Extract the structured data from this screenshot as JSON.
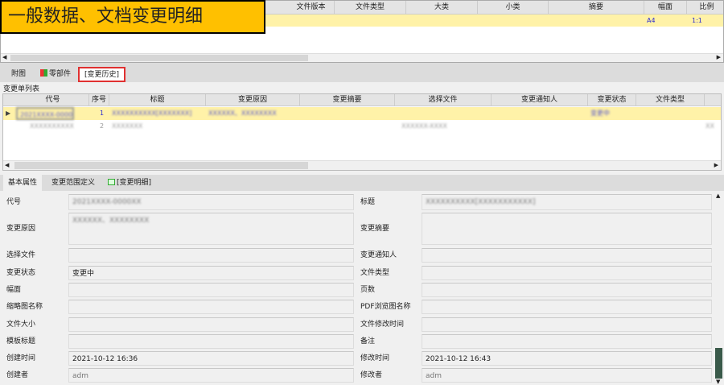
{
  "overlay_title": "一般数据、文档变更明细",
  "top_grid": {
    "columns": [
      "文件版本",
      "文件类型",
      "大类",
      "小类",
      "摘要",
      "幅面",
      "比例"
    ],
    "row": {
      "size": "A4",
      "scale": "1:1"
    }
  },
  "top_tabs": [
    "附图",
    "零部件",
    "[变更历史]"
  ],
  "change_list": {
    "title": "变更单列表",
    "columns": [
      "代号",
      "序号",
      "标题",
      "变更原因",
      "变更摘要",
      "选择文件",
      "变更通知人",
      "变更状态",
      "文件类型"
    ],
    "rows": [
      {
        "indicator": "▶",
        "code": "2021XXXX-0000XX",
        "seq": "1",
        "title": "XXXXXXXXXX[XXXXXXX]",
        "reason": "XXXXXX、XXXXXXXX",
        "file": "",
        "status": "变更中",
        "type": ""
      },
      {
        "indicator": "",
        "code": "XXXXXXXXXX",
        "seq": "2",
        "title": "XXXXXXX",
        "reason": "",
        "file": "XXXXXX-XXXX",
        "status": "",
        "type": "XX"
      }
    ]
  },
  "bottom_tabs": [
    "基本属性",
    "变更范围定义",
    "[变更明细]"
  ],
  "form": {
    "left": [
      {
        "label": "代号",
        "value": "2021XXXX-0000XX",
        "blurred": true
      },
      {
        "label": "变更原因",
        "value": "XXXXXX、XXXXXXXX",
        "blurred": true
      },
      {
        "label": "选择文件",
        "value": ""
      },
      {
        "label": "变更状态",
        "value": "变更中"
      },
      {
        "label": "幅面",
        "value": ""
      },
      {
        "label": "缩略图名称",
        "value": ""
      },
      {
        "label": "文件大小",
        "value": ""
      },
      {
        "label": "模板标题",
        "value": ""
      },
      {
        "label": "创建时间",
        "value": "2021-10-12 16:36"
      },
      {
        "label": "创建者",
        "value": "adm"
      }
    ],
    "right": [
      {
        "label": "标题",
        "value": "XXXXXXXXXX[XXXXXXXXXXX]",
        "blurred": true
      },
      {
        "label": "变更摘要",
        "value": ""
      },
      {
        "label": "变更通知人",
        "value": ""
      },
      {
        "label": "文件类型",
        "value": ""
      },
      {
        "label": "页数",
        "value": ""
      },
      {
        "label": "PDF浏览图名称",
        "value": ""
      },
      {
        "label": "文件修改时间",
        "value": ""
      },
      {
        "label": "备注",
        "value": ""
      },
      {
        "label": "修改时间",
        "value": "2021-10-12 16:43"
      },
      {
        "label": "修改者",
        "value": "adm"
      }
    ]
  },
  "colors": {
    "highlight_row": "#fff2a8",
    "overlay_bg": "#ffc000",
    "annotation": "#e03030"
  }
}
